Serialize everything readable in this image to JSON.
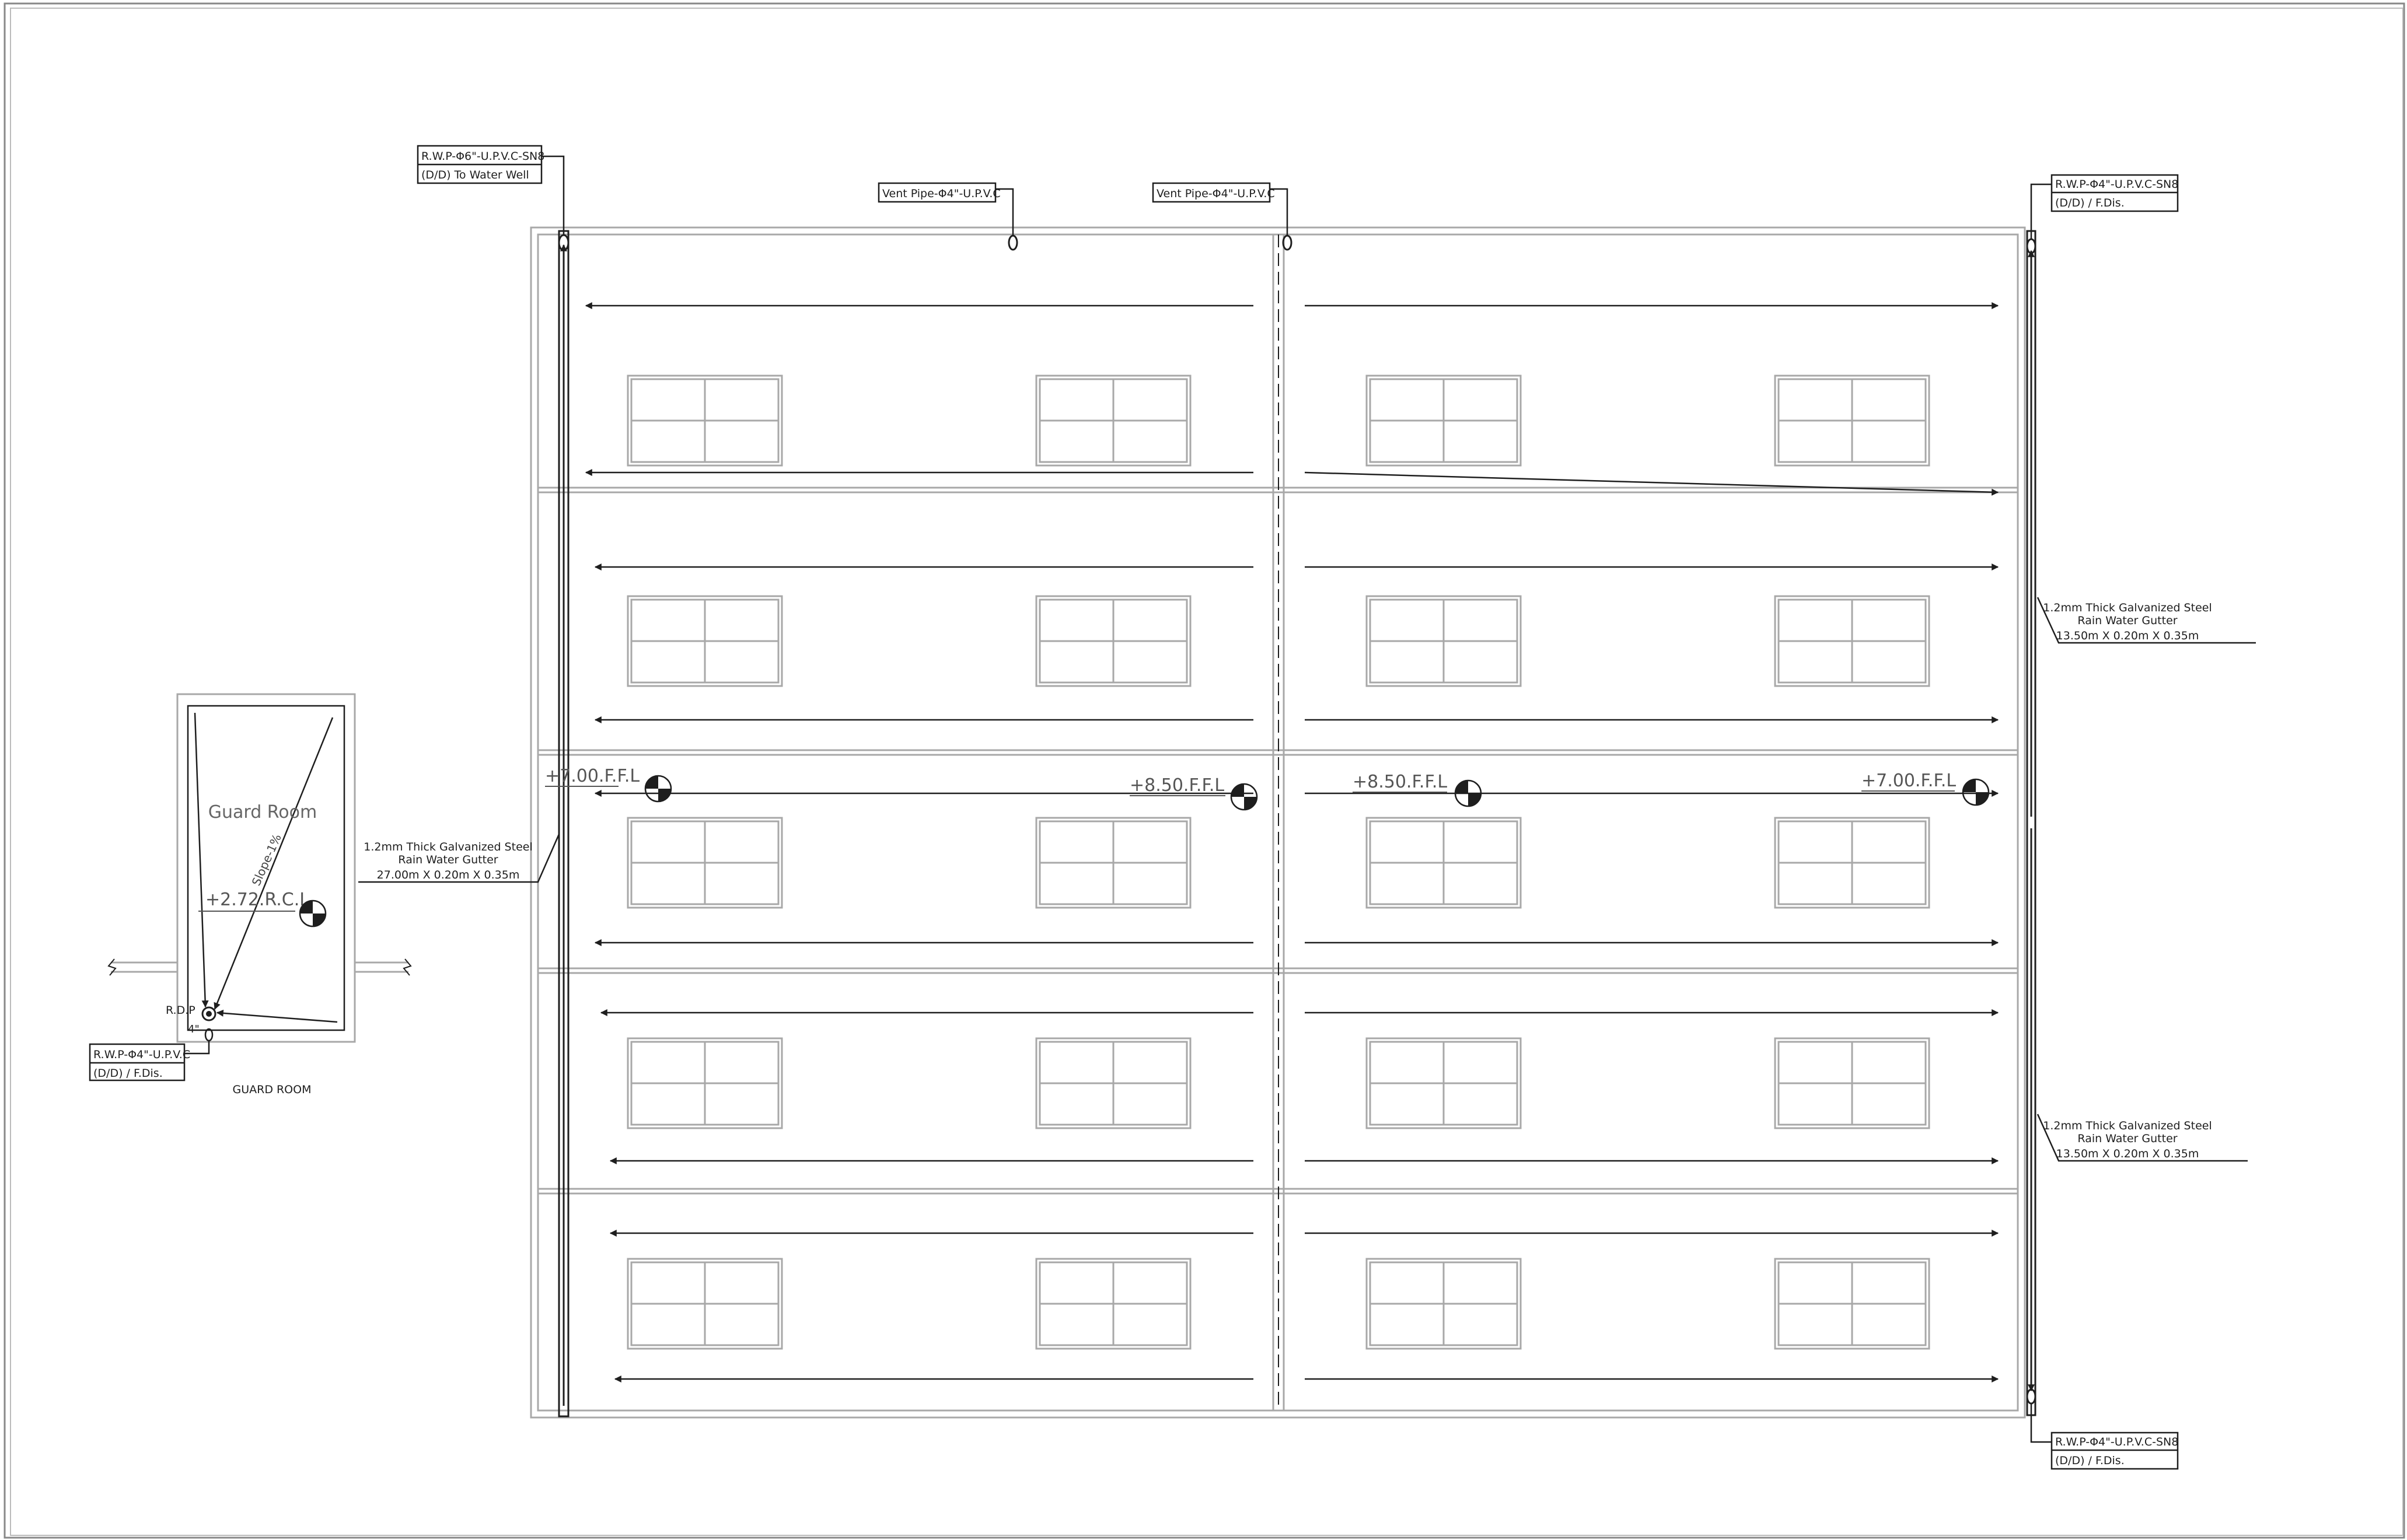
{
  "tags": {
    "rwp_main_line1": "R.W.P-Φ6\"-U.P.V.C-SN8",
    "rwp_main_line2": "(D/D) To Water Well",
    "vent1": "Vent Pipe-Φ4\"-U.P.V.C",
    "vent2": "Vent Pipe-Φ4\"-U.P.V.C",
    "rwp_right_top_line1": "R.W.P-Φ4\"-U.P.V.C-SN8",
    "rwp_right_top_line2": "(D/D) / F.Dis.",
    "rwp_right_bottom_line1": "R.W.P-Φ4\"-U.P.V.C-SN8",
    "rwp_right_bottom_line2": "(D/D) / F.Dis.",
    "rwp_guard_line1": "R.W.P-Φ4\"-U.P.V.C",
    "rwp_guard_line2": "(D/D) / F.Dis."
  },
  "gutters": {
    "left": [
      "1.2mm Thick Galvanized Steel",
      "Rain Water Gutter",
      "27.00m X 0.20m X 0.35m"
    ],
    "right_upper": [
      "1.2mm Thick Galvanized Steel",
      "Rain Water Gutter",
      "13.50m X 0.20m X 0.35m"
    ],
    "right_lower": [
      "1.2mm Thick Galvanized Steel",
      "Rain Water Gutter",
      "13.50m X 0.20m X 0.35m"
    ]
  },
  "levels": {
    "left_outer": "+7.00.F.F.L",
    "left_inner": "+8.50.F.F.L",
    "right_inner": "+8.50.F.F.L",
    "right_outer": "+7.00.F.F.L",
    "guard_roof": "+2.72.R.C.L"
  },
  "guard_room": {
    "room_label": "Guard Room",
    "slope_label": "Slope-1%",
    "rdp_label": "R.D.P",
    "pipe_size": "4\"",
    "caption": "GUARD ROOM"
  },
  "roof_slopes": {
    "left_half": "toward left outer edge",
    "right_half": "toward right outer edge"
  },
  "colors": {
    "line": "#1e1e1e",
    "light_line": "#a8a8a8",
    "background": "#ffffff"
  }
}
